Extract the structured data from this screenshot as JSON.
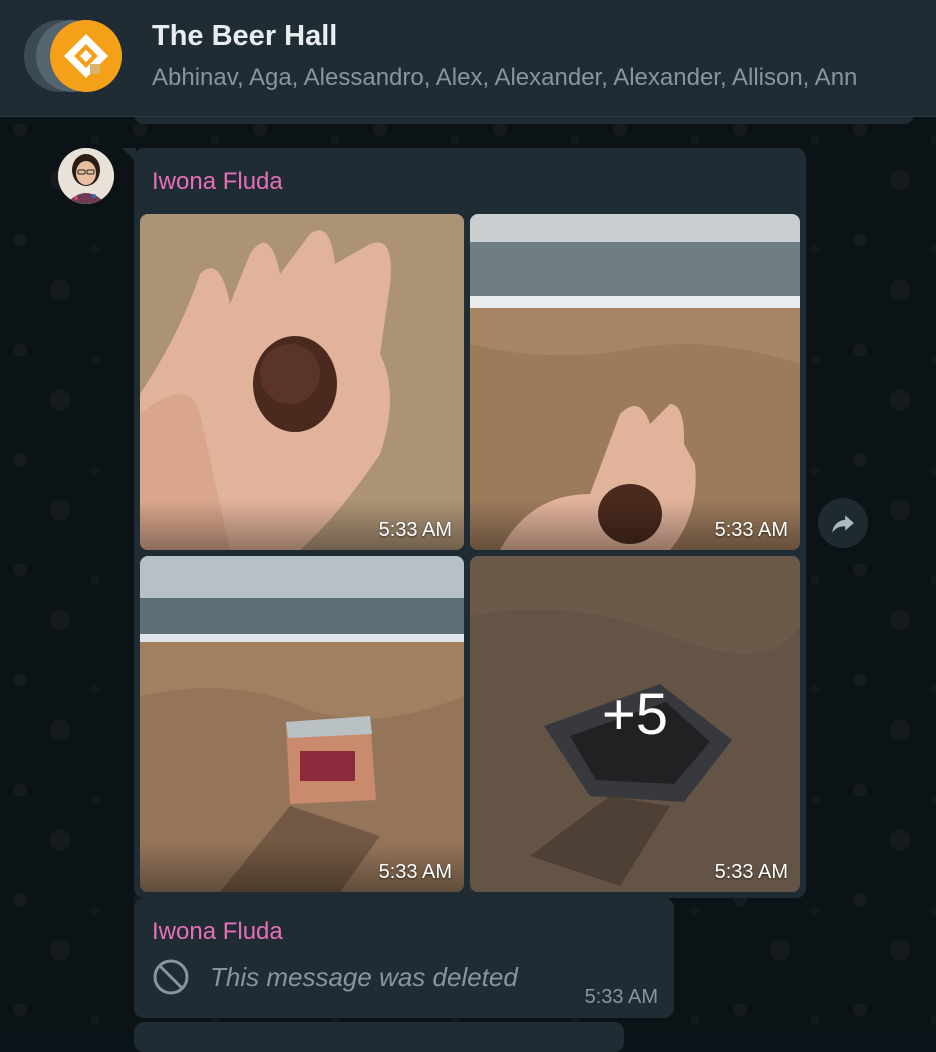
{
  "header": {
    "title": "The Beer Hall",
    "members": "Abhinav, Aga, Alessandro, Alex, Alexander, Alexander, Allison, Ann"
  },
  "album_message": {
    "sender": "Iwona Fluda",
    "photos": [
      {
        "time": "5:33 AM"
      },
      {
        "time": "5:33 AM"
      },
      {
        "time": "5:33 AM"
      },
      {
        "time": "5:33 AM",
        "more": "+5"
      }
    ]
  },
  "deleted_message": {
    "sender": "Iwona Fluda",
    "text": "This message was deleted",
    "time": "5:33 AM"
  },
  "colors": {
    "sender_name": "#e76fb9",
    "bubble": "#202c33",
    "header": "#1f2c33"
  },
  "icons": {
    "forward": "forward-arrow-icon",
    "deleted": "blocked-circle-icon"
  }
}
